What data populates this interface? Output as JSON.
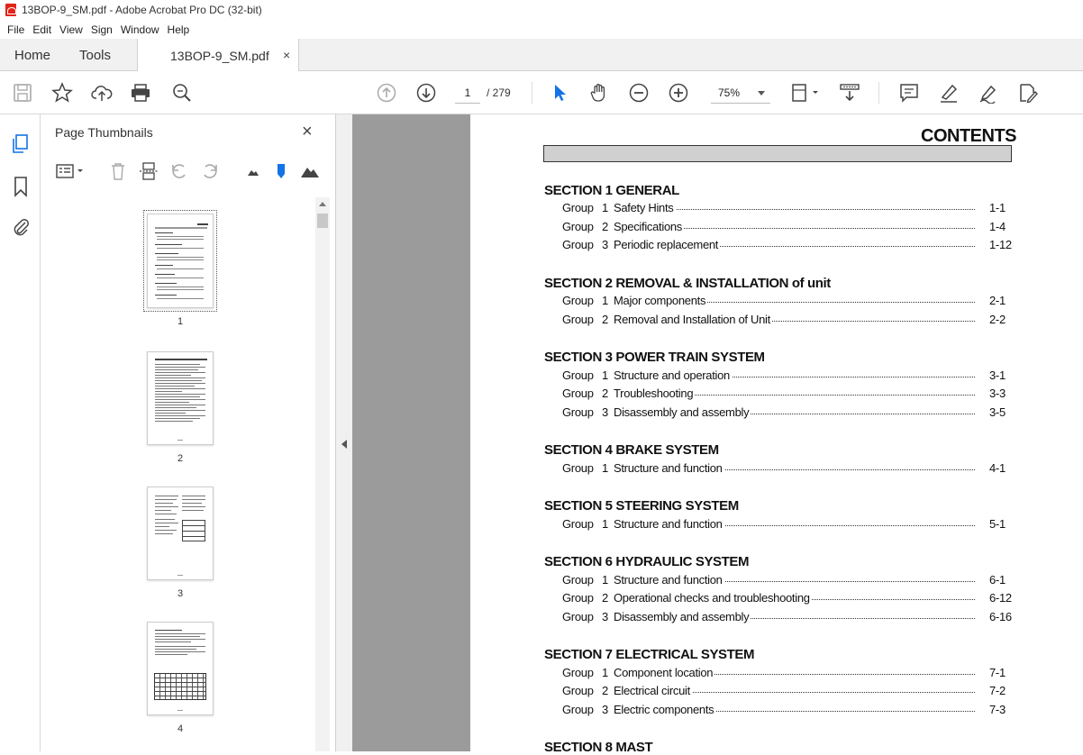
{
  "window": {
    "title": "13BOP-9_SM.pdf - Adobe Acrobat Pro DC (32-bit)"
  },
  "menu": [
    "File",
    "Edit",
    "View",
    "Sign",
    "Window",
    "Help"
  ],
  "tabs": {
    "home": "Home",
    "tools": "Tools",
    "document": "13BOP-9_SM.pdf",
    "close": "×"
  },
  "toolbar": {
    "page_current": "1",
    "page_total": "/  279",
    "zoom": "75%"
  },
  "thumbnails": {
    "title": "Page Thumbnails",
    "close": "×",
    "pages": [
      "1",
      "2",
      "3",
      "4"
    ]
  },
  "document": {
    "heading": "CONTENTS",
    "sections": [
      {
        "title": "SECTION 1  GENERAL",
        "entries": [
          {
            "group": "Group",
            "num": "1",
            "text": "Safety Hints",
            "page": "1-1"
          },
          {
            "group": "Group",
            "num": "2",
            "text": "Specifications",
            "page": "1-4"
          },
          {
            "group": "Group",
            "num": "3",
            "text": "Periodic replacement",
            "page": "1-12"
          }
        ]
      },
      {
        "title": "SECTION 2  REMOVAL & INSTALLATION of unit",
        "entries": [
          {
            "group": "Group",
            "num": "1",
            "text": "Major components",
            "page": "2-1"
          },
          {
            "group": "Group",
            "num": "2",
            "text": "Removal and Installation of Unit",
            "page": "2-2"
          }
        ]
      },
      {
        "title": "SECTION 3  POWER TRAIN SYSTEM",
        "entries": [
          {
            "group": "Group",
            "num": "1",
            "text": "Structure and operation",
            "page": "3-1"
          },
          {
            "group": "Group",
            "num": "2",
            "text": "Troubleshooting",
            "page": "3-3"
          },
          {
            "group": "Group",
            "num": "3",
            "text": "Disassembly and assembly",
            "page": "3-5"
          }
        ]
      },
      {
        "title": "SECTION 4  BRAKE SYSTEM",
        "entries": [
          {
            "group": "Group",
            "num": "1",
            "text": "Structure and function",
            "page": "4-1"
          }
        ]
      },
      {
        "title": "SECTION 5  STEERING SYSTEM",
        "entries": [
          {
            "group": "Group",
            "num": "1",
            "text": "Structure and function",
            "page": "5-1"
          }
        ]
      },
      {
        "title": "SECTION 6  HYDRAULIC SYSTEM",
        "entries": [
          {
            "group": "Group",
            "num": "1",
            "text": "Structure and function",
            "page": "6-1"
          },
          {
            "group": "Group",
            "num": "2",
            "text": "Operational checks and troubleshooting",
            "page": "6-12"
          },
          {
            "group": "Group",
            "num": "3",
            "text": "Disassembly and assembly",
            "page": "6-16"
          }
        ]
      },
      {
        "title": "SECTION 7  ELECTRICAL SYSTEM",
        "entries": [
          {
            "group": "Group",
            "num": "1",
            "text": "Component location",
            "page": "7-1"
          },
          {
            "group": "Group",
            "num": "2",
            "text": "Electrical circuit",
            "page": "7-2"
          },
          {
            "group": "Group",
            "num": "3",
            "text": "Electric components",
            "page": "7-3"
          }
        ]
      },
      {
        "title": "SECTION 8  MAST",
        "entries": []
      }
    ]
  }
}
